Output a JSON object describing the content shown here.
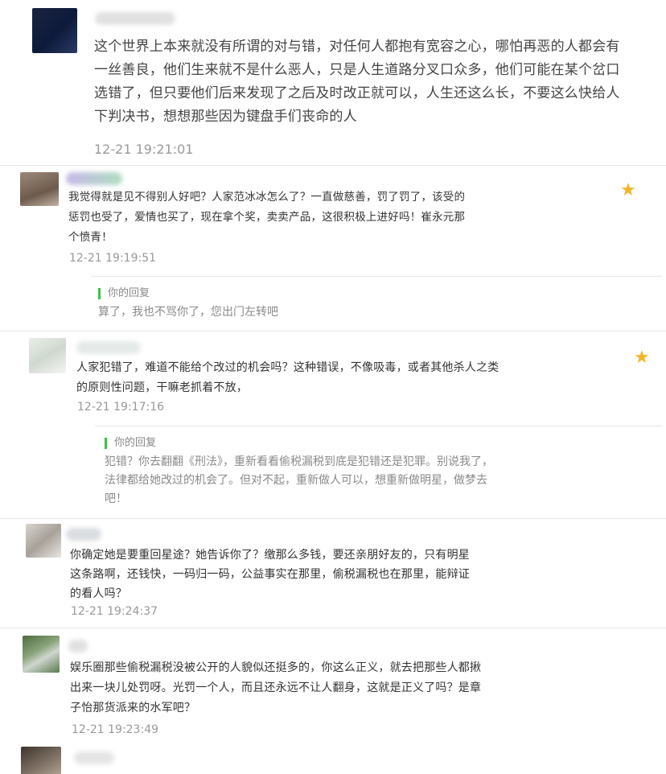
{
  "comments": [
    {
      "text": "这个世界上本来就没有所谓的对与错，对任何人都抱有宽容之心，哪怕再恶的人都会有一丝善良，他们生来就不是什么恶人，只是人生道路分叉口众多，他们可能在某个岔口选错了，但只要他们后来发现了之后及时改正就可以，人生还这么长，不要这么快给人下判决书，想想那些因为键盘手们丧命的人",
      "time": "12-21 19:21:01"
    },
    {
      "text": "我觉得就是见不得别人好吧？人家范冰冰怎么了？一直做慈善，罚了罚了，该受的惩罚也受了，爱情也买了，现在拿个奖，卖卖产品，这很积极上进好吗！崔永元那个愤青！",
      "time": "12-21 19:19:51",
      "starred": true,
      "reply_label": "你的回复",
      "reply_text": "算了，我也不骂你了，您出门左转吧"
    },
    {
      "text": "人家犯错了，难道不能给个改过的机会吗？这种错误，不像吸毒，或者其他杀人之类的原则性问题，干嘛老抓着不放，",
      "time": "12-21 19:17:16",
      "starred": true,
      "reply_label": "你的回复",
      "reply_text": "犯错？你去翻翻《刑法》，重新看看偷税漏税到底是犯错还是犯罪。别说我了，法律都给她改过的机会了。但对不起，重新做人可以，想重新做明星，做梦去吧！"
    },
    {
      "text": "你确定她是要重回星途？她告诉你了？缴那么多钱，要还亲朋好友的，只有明星这条路啊，还钱快，一码归一码，公益事实在那里，偷税漏税也在那里，能辩证的看人吗？",
      "time": "12-21 19:24:37"
    },
    {
      "text": "娱乐圈那些偷税漏税没被公开的人貌似还挺多的，你这么正义，就去把那些人都揪出来一块儿处罚呀。光罚一个人，而且还永远不让人翻身，这就是正义了吗？是章子怡那货派来的水军吧？",
      "time": "12-21 19:23:49"
    }
  ],
  "icons": {
    "star": "star-icon"
  },
  "colors": {
    "star": "#f5b428",
    "reply_bar": "#3bbf4a",
    "time": "#999999"
  }
}
